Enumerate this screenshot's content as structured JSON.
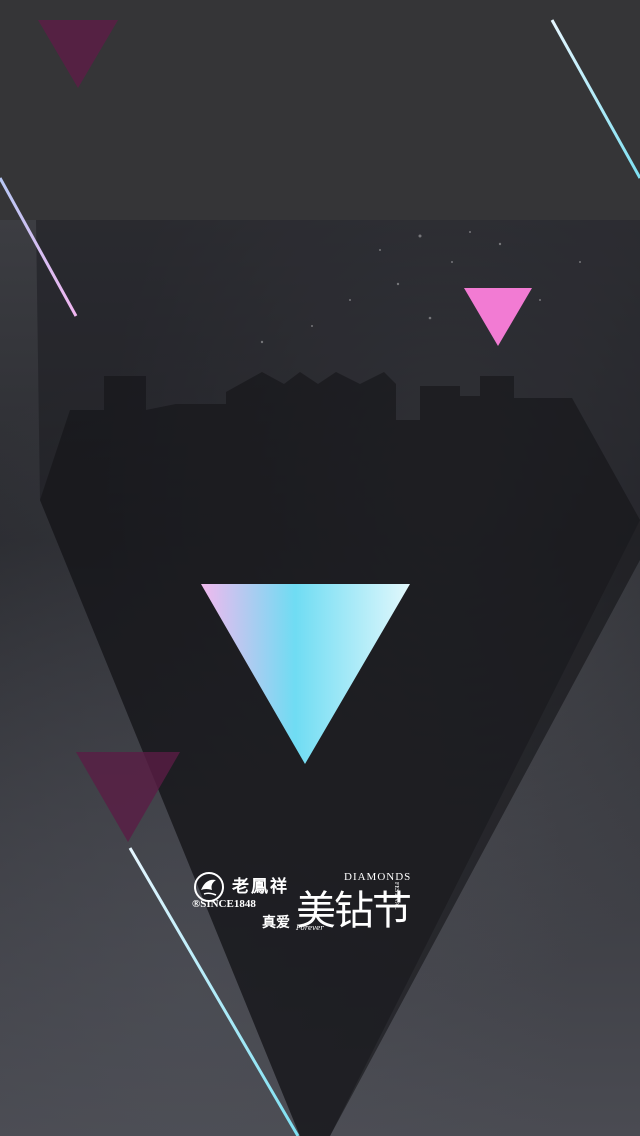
{
  "brand": {
    "name_cn": "老鳳祥",
    "since": "SINCE1848",
    "registered_mark": "®",
    "emblem_text": "老鳳祥"
  },
  "festival": {
    "title_cn": "美钻节",
    "diamonds": "DIAMONDS",
    "festival_en": "FESTIVAL",
    "tagline_cn": "真爱",
    "forever": "Forever"
  },
  "colors": {
    "background": "#303033",
    "pink_accent": "#f27bd3",
    "cyan_accent": "#7ee0f2",
    "dark_magenta": "#5a1d45",
    "gradient_pink": "#f1b9ee",
    "gradient_cyan": "#6fdcf3",
    "gradient_white": "#e2f8fc"
  },
  "icons": {
    "center_triangle": "gradient-inverted-triangle-icon",
    "pink_triangle": "pink-triangle-icon",
    "dark_triangle_top": "dark-triangle-icon",
    "dark_triangle_bottom": "dark-triangle-icon",
    "emblem": "phoenix-emblem-icon"
  }
}
